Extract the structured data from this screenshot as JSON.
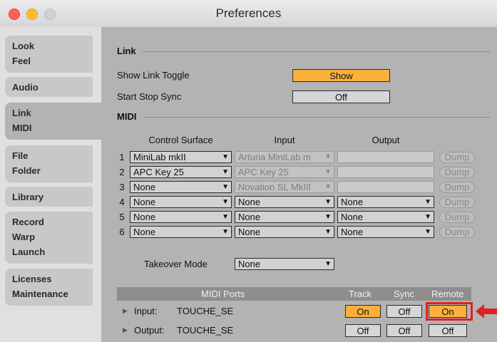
{
  "window": {
    "title": "Preferences"
  },
  "sidebar": {
    "tabs": [
      {
        "lines": [
          "Look",
          "Feel"
        ]
      },
      {
        "lines": [
          "Audio"
        ]
      },
      {
        "lines": [
          "Link",
          "MIDI"
        ]
      },
      {
        "lines": [
          "File",
          "Folder"
        ]
      },
      {
        "lines": [
          "Library"
        ]
      },
      {
        "lines": [
          "Record",
          "Warp",
          "Launch"
        ]
      },
      {
        "lines": [
          "Licenses",
          "Maintenance"
        ]
      }
    ],
    "active_index": 2
  },
  "link": {
    "heading": "Link",
    "show_toggle_label": "Show Link Toggle",
    "show_toggle_value": "Show",
    "start_stop_label": "Start Stop Sync",
    "start_stop_value": "Off"
  },
  "midi": {
    "heading": "MIDI",
    "col_control_surface": "Control Surface",
    "col_input": "Input",
    "col_output": "Output",
    "dump_label": "Dump",
    "rows": [
      {
        "num": "1",
        "surface": "MiniLab mkII",
        "input": "Arturia MiniLab m",
        "output": ""
      },
      {
        "num": "2",
        "surface": "APC Key 25",
        "input": "APC Key 25",
        "output": ""
      },
      {
        "num": "3",
        "surface": "None",
        "input": "Novation SL MkIII",
        "output": ""
      },
      {
        "num": "4",
        "surface": "None",
        "input": "None",
        "output": "None"
      },
      {
        "num": "5",
        "surface": "None",
        "input": "None",
        "output": "None"
      },
      {
        "num": "6",
        "surface": "None",
        "input": "None",
        "output": "None"
      }
    ],
    "takeover_label": "Takeover Mode",
    "takeover_value": "None"
  },
  "ports": {
    "header": "MIDI Ports",
    "col_track": "Track",
    "col_sync": "Sync",
    "col_remote": "Remote",
    "rows": [
      {
        "label": "Input:",
        "name": "TOUCHE_SE",
        "track": "On",
        "sync": "Off",
        "remote": "On"
      },
      {
        "label": "Output:",
        "name": "TOUCHE_SE",
        "track": "Off",
        "sync": "Off",
        "remote": "Off"
      }
    ]
  },
  "colors": {
    "accent_orange": "#fbb03b",
    "highlight_red": "#e02020"
  }
}
